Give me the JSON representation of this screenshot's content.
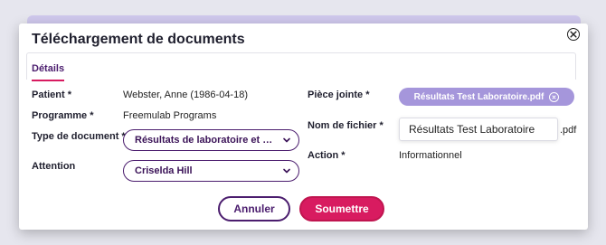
{
  "modal": {
    "title": "Téléchargement de documents",
    "close_icon": "close-circle-icon"
  },
  "tabs": [
    {
      "label": "Détails",
      "active": true
    }
  ],
  "form": {
    "patient_label": "Patient *",
    "patient_value": "Webster, Anne (1986-04-18)",
    "program_label": "Programme *",
    "program_value": "Freemulab Programs",
    "doc_type_label": "Type de document *",
    "doc_type_value": "Résultats de laboratoire et de te...",
    "attention_label": "Attention",
    "attention_value": "Criselda Hill",
    "attachment_label": "Pièce jointe *",
    "attachment_file": "Résultats Test Laboratoire.pdf",
    "filename_label": "Nom de fichier *",
    "filename_value": "Résultats Test Laboratoire",
    "filename_ext": ".pdf",
    "action_label": "Action *",
    "action_value": "Informationnel"
  },
  "buttons": {
    "cancel": "Annuler",
    "submit": "Soumettre"
  },
  "colors": {
    "accent_purple": "#4b1d6e",
    "accent_pink": "#d81b60",
    "chip_lavender": "#a596db"
  }
}
